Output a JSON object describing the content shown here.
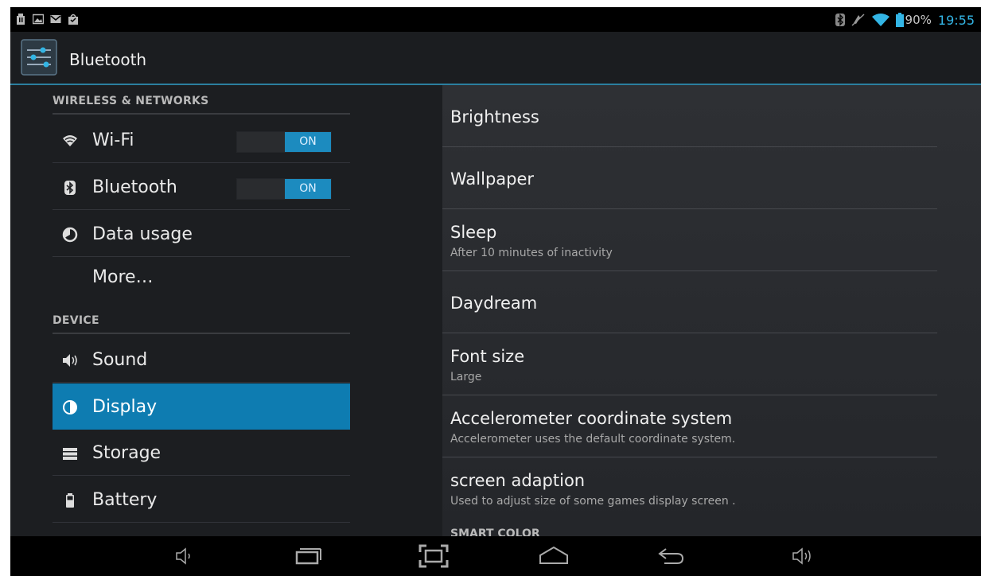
{
  "status_bar": {
    "battery_percent": "90%",
    "time": "19:55",
    "left_icons": [
      "usb-icon",
      "image-icon",
      "gmail-icon",
      "shopping-bag-icon"
    ],
    "right_icons": [
      "bluetooth-icon",
      "mute-icon",
      "wifi-icon",
      "battery-icon"
    ]
  },
  "action_bar": {
    "title": "Bluetooth",
    "icon": "settings-sliders-icon"
  },
  "left_panel": {
    "section_wireless": "WIRELESS & NETWORKS",
    "section_device": "DEVICE",
    "items": [
      {
        "label": "Wi-Fi",
        "icon": "wifi-icon",
        "toggle": "ON"
      },
      {
        "label": "Bluetooth",
        "icon": "bluetooth-icon",
        "toggle": "ON"
      },
      {
        "label": "Data usage",
        "icon": "data-usage-icon"
      },
      {
        "label": "More…"
      },
      {
        "label": "Sound",
        "icon": "speaker-icon"
      },
      {
        "label": "Display",
        "icon": "display-icon",
        "selected": true
      },
      {
        "label": "Storage",
        "icon": "storage-icon"
      },
      {
        "label": "Battery",
        "icon": "battery-icon"
      }
    ]
  },
  "right_panel": {
    "items": [
      {
        "title": "Brightness"
      },
      {
        "title": "Wallpaper"
      },
      {
        "title": "Sleep",
        "subtitle": "After 10 minutes of inactivity"
      },
      {
        "title": "Daydream"
      },
      {
        "title": "Font size",
        "subtitle": "Large"
      },
      {
        "title": "Accelerometer coordinate system",
        "subtitle": "Accelerometer uses the default coordinate system."
      },
      {
        "title": "screen adaption",
        "subtitle": "Used to adjust size of some games display screen ."
      }
    ],
    "cut_off_header": "SMART COLOR"
  },
  "nav_bar": {
    "buttons": [
      "volume-down-icon",
      "recent-apps-icon",
      "screenshot-icon",
      "home-icon",
      "back-icon",
      "volume-up-icon"
    ]
  },
  "colors": {
    "accent": "#33b5e5",
    "selected": "#0e7cb1",
    "toggle_on": "#1c8bbf"
  }
}
